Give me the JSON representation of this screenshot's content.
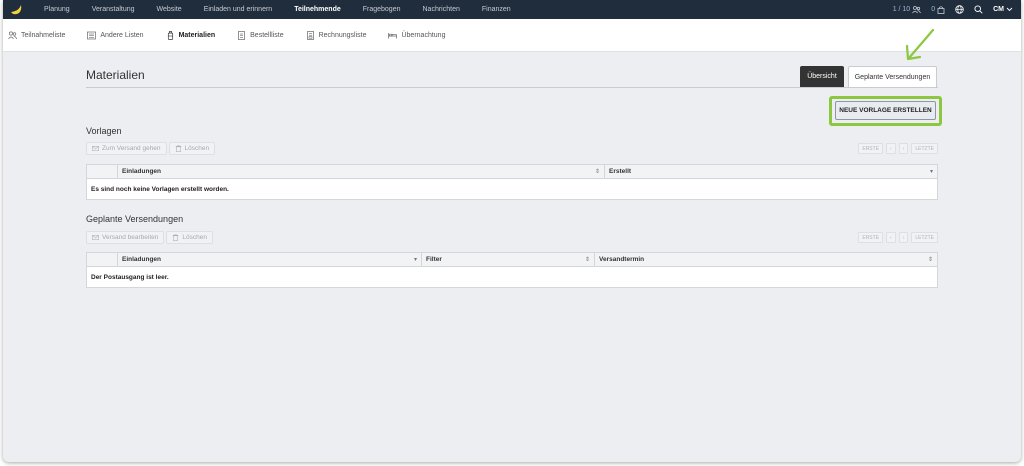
{
  "topnav": {
    "items": [
      {
        "label": "Planung",
        "active": false
      },
      {
        "label": "Veranstaltung",
        "active": false
      },
      {
        "label": "Website",
        "active": false
      },
      {
        "label": "Einladen und erinnern",
        "active": false
      },
      {
        "label": "Teilnehmende",
        "active": true
      },
      {
        "label": "Fragebogen",
        "active": false
      },
      {
        "label": "Nachrichten",
        "active": false
      },
      {
        "label": "Finanzen",
        "active": false
      }
    ],
    "participants_count": "1 / 10",
    "orders_count": "0",
    "user_initials": "CM",
    "accent": "#1f2d3d"
  },
  "subnav": {
    "items": [
      {
        "label": "Teilnahmeliste",
        "icon": "people-icon",
        "active": false
      },
      {
        "label": "Andere Listen",
        "icon": "list-icon",
        "active": false
      },
      {
        "label": "Materialien",
        "icon": "bottle-icon",
        "active": true
      },
      {
        "label": "Bestellliste",
        "icon": "document-icon",
        "active": false
      },
      {
        "label": "Rechnungsliste",
        "icon": "invoice-icon",
        "active": false
      },
      {
        "label": "Übernachtung",
        "icon": "bed-icon",
        "active": false
      }
    ]
  },
  "page": {
    "title": "Materialien",
    "tab_overview": "Übersicht",
    "tab_scheduled": "Geplante Versendungen",
    "new_template_button": "NEUE VORLAGE ERSTELLEN",
    "highlight_color": "#8dc63f"
  },
  "templates": {
    "title": "Vorlagen",
    "btn_send": "Zum Versand gehen",
    "btn_delete": "Löschen",
    "pager": {
      "first": "ERSTE",
      "prev": "‹",
      "next": "›",
      "last": "LETZTE"
    },
    "columns": [
      "Einladungen",
      "Erstellt"
    ],
    "empty_message": "Es sind noch keine Vorlagen erstellt worden."
  },
  "scheduled": {
    "title": "Geplante Versendungen",
    "btn_edit": "Versand bearbeiten",
    "btn_delete": "Löschen",
    "pager": {
      "first": "ERSTE",
      "prev": "‹",
      "next": "›",
      "last": "LETZTE"
    },
    "columns": [
      "Einladungen",
      "Filter",
      "Versandtermin"
    ],
    "empty_message": "Der Postausgang ist leer."
  }
}
